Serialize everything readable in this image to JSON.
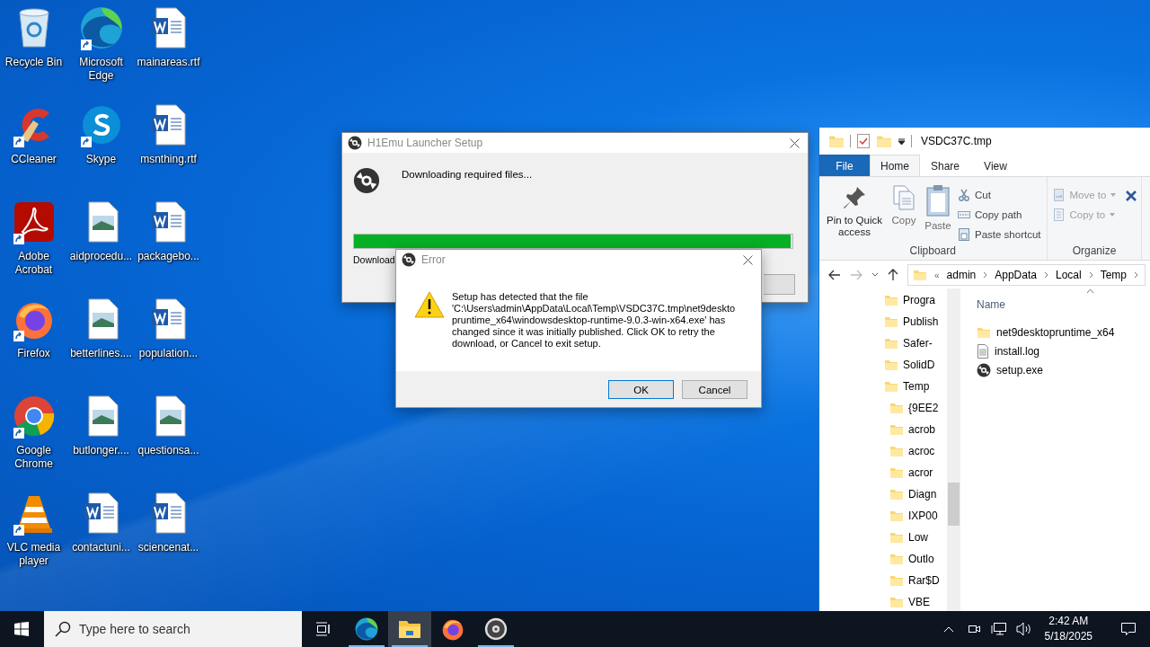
{
  "desktop_icons": [
    {
      "label": "Recycle Bin",
      "kind": "recycle",
      "shortcut": false
    },
    {
      "label": "CCleaner",
      "kind": "ccleaner",
      "shortcut": true
    },
    {
      "label": "Adobe Acrobat",
      "kind": "acrobat",
      "shortcut": true
    },
    {
      "label": "Firefox",
      "kind": "firefox",
      "shortcut": true
    },
    {
      "label": "Google Chrome",
      "kind": "chrome",
      "shortcut": true
    },
    {
      "label": "VLC media player",
      "kind": "vlc",
      "shortcut": true
    },
    {
      "label": "Microsoft Edge",
      "kind": "edge",
      "shortcut": true
    },
    {
      "label": "Skype",
      "kind": "skype",
      "shortcut": true
    },
    {
      "label": "aidprocedu...",
      "kind": "image",
      "shortcut": false
    },
    {
      "label": "betterlines....",
      "kind": "image",
      "shortcut": false
    },
    {
      "label": "butlonger....",
      "kind": "image",
      "shortcut": false
    },
    {
      "label": "contactuni...",
      "kind": "word",
      "shortcut": false
    },
    {
      "label": "mainareas.rtf",
      "kind": "word",
      "shortcut": false
    },
    {
      "label": "msnthing.rtf",
      "kind": "word",
      "shortcut": false
    },
    {
      "label": "packagebo...",
      "kind": "word",
      "shortcut": false
    },
    {
      "label": "population...",
      "kind": "word",
      "shortcut": false
    },
    {
      "label": "questionsa...",
      "kind": "image",
      "shortcut": false
    },
    {
      "label": "sciencenat...",
      "kind": "word",
      "shortcut": false
    }
  ],
  "setup_window": {
    "title": "H1Emu Launcher Setup",
    "message": "Downloading required files...",
    "progress": {
      "level": 0.995
    },
    "status": "Download"
  },
  "error_dialog": {
    "title": "Error",
    "message": "Setup has detected that the file 'C:\\Users\\admin\\AppData\\Local\\Temp\\VSDC37C.tmp\\net9desktopruntime_x64\\windowsdesktop-runtime-9.0.3-win-x64.exe' has changed since it was initially published. Click OK to retry the download, or Cancel to exit setup.",
    "buttons": [
      "OK",
      "Cancel"
    ]
  },
  "explorer": {
    "title": "VSDC37C.tmp",
    "ribbon_tabs": [
      {
        "label": "File",
        "kind": "file",
        "selected": false
      },
      {
        "label": "Home",
        "kind": "tab",
        "selected": true
      },
      {
        "label": "Share",
        "kind": "tab",
        "selected": false
      },
      {
        "label": "View",
        "kind": "tab",
        "selected": false
      }
    ],
    "clipboard": {
      "large": [
        {
          "label": "Pin to Quick access",
          "kind": "pin",
          "disabled": false
        },
        {
          "label": "Copy",
          "kind": "copy",
          "disabled": true
        },
        {
          "label": "Paste",
          "kind": "paste",
          "disabled": true
        }
      ],
      "small": [
        {
          "label": "Cut",
          "kind": "cut",
          "disabled": false
        },
        {
          "label": "Copy path",
          "kind": "copypath",
          "disabled": false
        },
        {
          "label": "Paste shortcut",
          "kind": "shortcut",
          "disabled": false
        }
      ],
      "group": "Clipboard"
    },
    "organize": {
      "items": [
        {
          "label": "Move to",
          "kind": "move",
          "disabled": true
        },
        {
          "label": "Copy to",
          "kind": "copyto",
          "disabled": true
        }
      ],
      "group": "Organize"
    },
    "address": {
      "overflow": "«",
      "parts": [
        "admin",
        "AppData",
        "Local",
        "Temp"
      ]
    },
    "nav_pane": [
      {
        "label": "Progra"
      },
      {
        "label": "Publish"
      },
      {
        "label": "Safer-"
      },
      {
        "label": "SolidD"
      },
      {
        "label": "Temp",
        "children": [
          {
            "label": "{9EE2"
          },
          {
            "label": "acrob"
          },
          {
            "label": "acroc"
          },
          {
            "label": "acror"
          },
          {
            "label": "Diagn"
          },
          {
            "label": "IXP00"
          },
          {
            "label": "Low"
          },
          {
            "label": "Outlo"
          },
          {
            "label": "Rar$D"
          },
          {
            "label": "VBE"
          }
        ]
      }
    ],
    "column": "Name",
    "files": [
      {
        "name": "net9desktopruntime_x64",
        "kind": "folder"
      },
      {
        "name": "install.log",
        "kind": "text"
      },
      {
        "name": "setup.exe",
        "kind": "setup"
      }
    ]
  },
  "taskbar": {
    "search_placeholder": "Type here to search",
    "apps": [
      {
        "kind": "edge",
        "running": true,
        "selected": false
      },
      {
        "kind": "explorer",
        "running": true,
        "selected": true
      },
      {
        "kind": "firefox",
        "running": false,
        "selected": false
      },
      {
        "kind": "setup",
        "running": true,
        "selected": false
      }
    ],
    "time": "2:42 AM",
    "date": "5/18/2025"
  }
}
